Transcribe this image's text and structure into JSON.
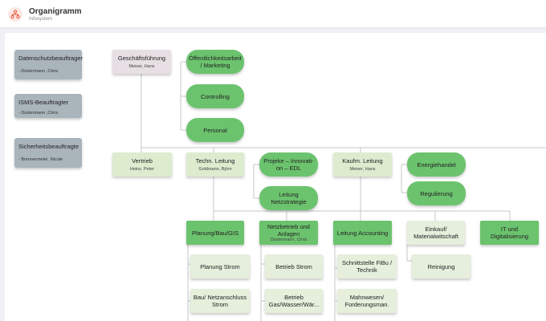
{
  "header": {
    "title": "Organigramm",
    "subtitle": "Infosystem",
    "icon": "org-chart-icon",
    "accent": "#e2533a"
  },
  "sidebar": {
    "items": [
      {
        "title": "Datenschutzbeauftrager",
        "person": "Düstermann ,Chris"
      },
      {
        "title": "ISMS-Beauftragter",
        "person": "Düstermann ,Chris"
      },
      {
        "title": "Sicherheitsbeauftragte",
        "person": "Brennermeier ,Nicole"
      }
    ]
  },
  "nodes": {
    "gf": {
      "title": "Geschäftsführung",
      "person": "Meiser, Hans"
    },
    "oeff": {
      "title": "Öffentlichkeitsarbeit / Marketing"
    },
    "controlling": {
      "title": "Controlling"
    },
    "personal": {
      "title": "Personal"
    },
    "vertrieb": {
      "title": "Vertrieb",
      "person": "Heinz, Peter"
    },
    "techn": {
      "title": "Techn. Leitung",
      "person": "Goldmann, Björn"
    },
    "projekte": {
      "title": "Projeke – Innovati- on – EDL"
    },
    "netzstrategie": {
      "title": "Leitung Netzstrategie"
    },
    "kaufm": {
      "title": "Kaufm. Leitung",
      "person": "Meiser, Hans"
    },
    "energie": {
      "title": "Energiehandel"
    },
    "regulierung": {
      "title": "Regulierung"
    },
    "planung": {
      "title": "Planung/Bau/GIS"
    },
    "netzbetrieb": {
      "title": "Netzbetrieb und Anlagen",
      "person": "Düstermann, Chris"
    },
    "accounting": {
      "title": "Leitung Accounting"
    },
    "einkauf": {
      "title": "Einkauf/ Materialwitschaft"
    },
    "it": {
      "title": "IT und Digitalisierung"
    },
    "planung_strom": {
      "title": "Planung Strom"
    },
    "bau_netz": {
      "title": "Bau/ Netzanschluss Strom"
    },
    "betrieb_strom": {
      "title": "Betrieb Strom"
    },
    "betrieb_gas": {
      "title": "Betrieb Gas/Wasser/Wär..."
    },
    "schnittstelle": {
      "title": "Schnittstelle FiBu / Technik"
    },
    "mahnwesen": {
      "title": "Mahnwesen/ Forderungsman."
    },
    "reinigung": {
      "title": "Reinigung"
    }
  },
  "colors": {
    "background": "#eef0f3",
    "node_green": "#6cc36e",
    "node_light_green": "#ddeccf",
    "node_top": "#e7dfe3",
    "side_gray": "#a9b4bb",
    "connector": "#c4c7cb"
  }
}
